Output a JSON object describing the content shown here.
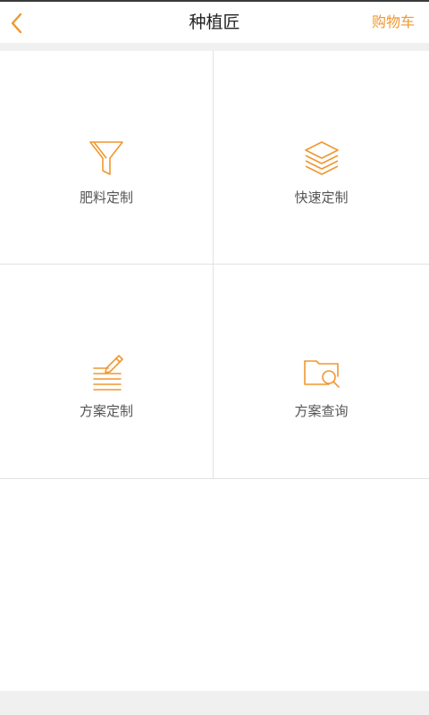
{
  "header": {
    "title": "种植匠",
    "cart_label": "购物车",
    "back_icon": "chevron-left-icon"
  },
  "colors": {
    "accent": "#f0972f",
    "divider": "#e2e2e2",
    "gap": "#f0f0f0"
  },
  "tiles": [
    {
      "label": "肥料定制",
      "icon": "funnel-icon"
    },
    {
      "label": "快速定制",
      "icon": "layers-icon"
    },
    {
      "label": "方案定制",
      "icon": "document-edit-icon"
    },
    {
      "label": "方案查询",
      "icon": "folder-search-icon"
    }
  ]
}
